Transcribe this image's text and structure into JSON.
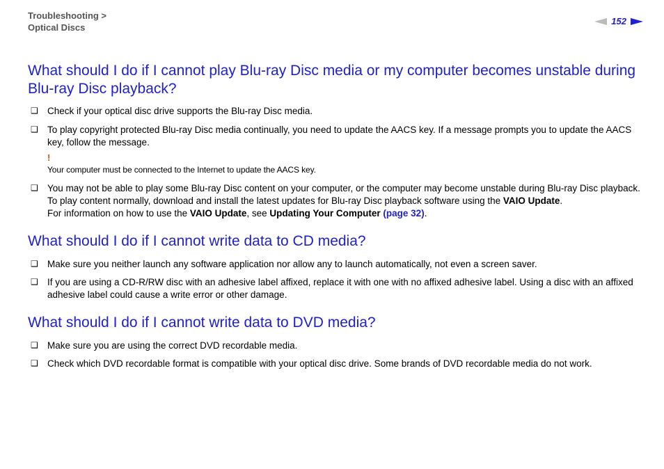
{
  "header": {
    "breadcrumb_line1": "Troubleshooting >",
    "breadcrumb_line2": "Optical Discs",
    "page_number": "152"
  },
  "sections": [
    {
      "heading": "What should I do if I cannot play Blu-ray Disc media or my computer becomes unstable during Blu-ray Disc playback?",
      "items": [
        {
          "text": "Check if your optical disc drive supports the Blu-ray Disc media."
        },
        {
          "text": "To play copyright protected Blu-ray Disc media continually, you need to update the AACS key. If a message prompts you to update the AACS key, follow the message.",
          "note_mark": "!",
          "note_text": "Your computer must be connected to the Internet to update the AACS key."
        },
        {
          "pre": "You may not be able to play some Blu-ray Disc content on your computer, or the computer may become unstable during Blu-ray Disc playback. To play content normally, download and install the latest updates for Blu-ray Disc playback software using the ",
          "bold1": "VAIO Update",
          "post1": ".",
          "br": true,
          "pre2": "For information on how to use the ",
          "bold2": "VAIO Update",
          "post2": ", see ",
          "bold3": "Updating Your Computer ",
          "link": "(page 32)",
          "post3": "."
        }
      ]
    },
    {
      "heading": "What should I do if I cannot write data to CD media?",
      "items": [
        {
          "text": "Make sure you neither launch any software application nor allow any to launch automatically, not even a screen saver."
        },
        {
          "text": "If you are using a CD-R/RW disc with an adhesive label affixed, replace it with one with no affixed adhesive label. Using a disc with an affixed adhesive label could cause a write error or other damage."
        }
      ]
    },
    {
      "heading": "What should I do if I cannot write data to DVD media?",
      "items": [
        {
          "text": "Make sure you are using the correct DVD recordable media."
        },
        {
          "text": "Check which DVD recordable format is compatible with your optical disc drive. Some brands of DVD recordable media do not work."
        }
      ]
    }
  ]
}
